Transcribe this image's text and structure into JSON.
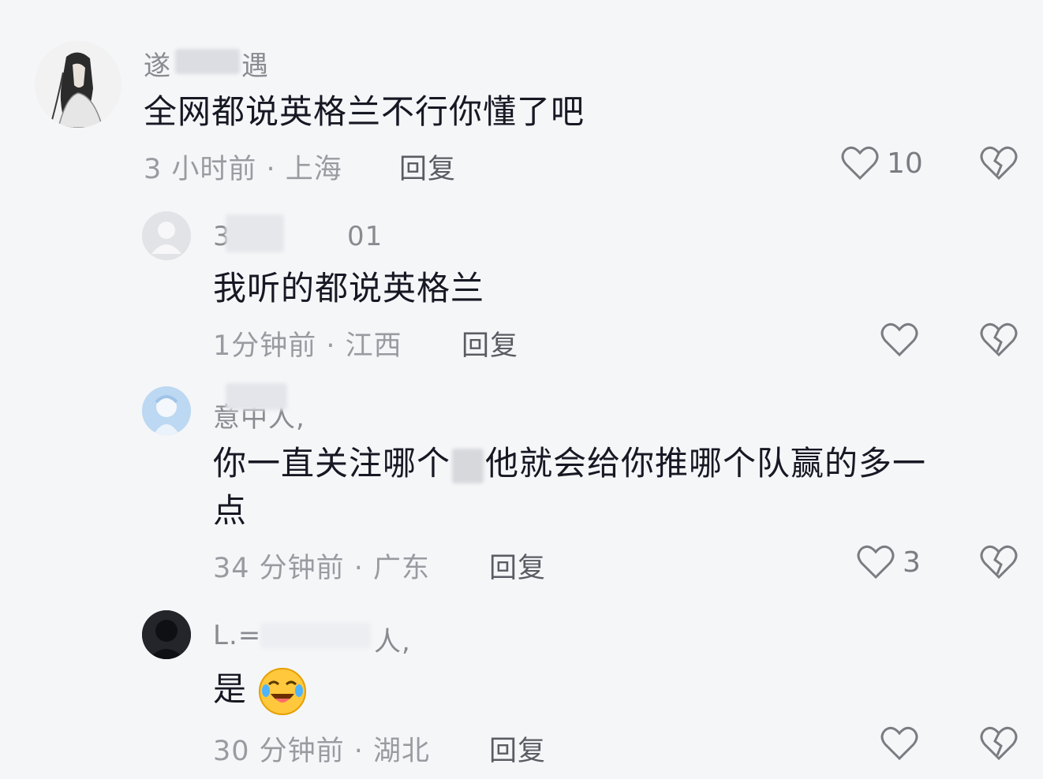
{
  "comments": [
    {
      "username": "遂",
      "username_tail": "遇",
      "text": "全网都说英格兰不行你懂了吧",
      "meta": "3 小时前 · 上海",
      "reply_label": "回复",
      "like_count": "10"
    },
    {
      "username": "3",
      "username_tail": "01",
      "text": "我听的都说英格兰",
      "meta": "1分钟前 · 江西",
      "reply_label": "回复",
      "like_count": ""
    },
    {
      "username": "意中人,",
      "username_tail": "",
      "text": "你一直关注哪个",
      "text_tail": "他就会给你推哪个队赢的多一",
      "text_line2": "点",
      "meta": "34 分钟前 · 广东",
      "reply_label": "回复",
      "like_count": "3"
    },
    {
      "username": "L.=",
      "username_tail": "人,",
      "text": "是",
      "meta": "30 分钟前 · 湖北",
      "reply_label": "回复",
      "like_count": "",
      "emoji": "rolling-laughing-emoji"
    }
  ],
  "icons": {
    "like": "heart-outline-icon",
    "dislike": "broken-heart-icon"
  },
  "colors": {
    "background": "#f5f6f8",
    "text_primary": "#161823",
    "text_secondary": "#9a9ba1",
    "icon": "#7b7c82"
  }
}
